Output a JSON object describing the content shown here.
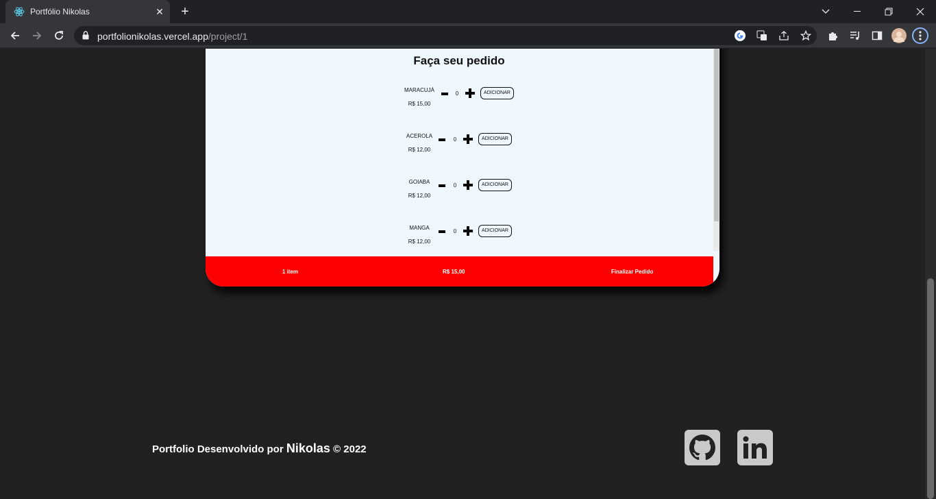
{
  "browser": {
    "tab_title": "Portfólio Nikolas",
    "url_host": "portfolionikolas.vercel.app",
    "url_path": "/project/1"
  },
  "order": {
    "title": "Faça seu pedido",
    "add_label": "ADICIONAR",
    "products": [
      {
        "name": "MARACUJÁ",
        "price": "R$ 15,00",
        "qty": "0"
      },
      {
        "name": "ACEROLA",
        "price": "R$ 12,00",
        "qty": "0"
      },
      {
        "name": "GOIABA",
        "price": "R$ 12,00",
        "qty": "0"
      },
      {
        "name": "MANGA",
        "price": "R$ 12,00",
        "qty": "0"
      }
    ],
    "summary": {
      "items": "1 item",
      "total": "R$ 15,00",
      "checkout": "Finalizar Pedido"
    },
    "accent_color": "#ff0000"
  },
  "footer": {
    "prefix": "Portfolio Desenvolvido por",
    "name": "Nikolas",
    "suffix": "© 2022",
    "links": [
      {
        "icon": "github-icon"
      },
      {
        "icon": "linkedin-icon"
      }
    ]
  }
}
